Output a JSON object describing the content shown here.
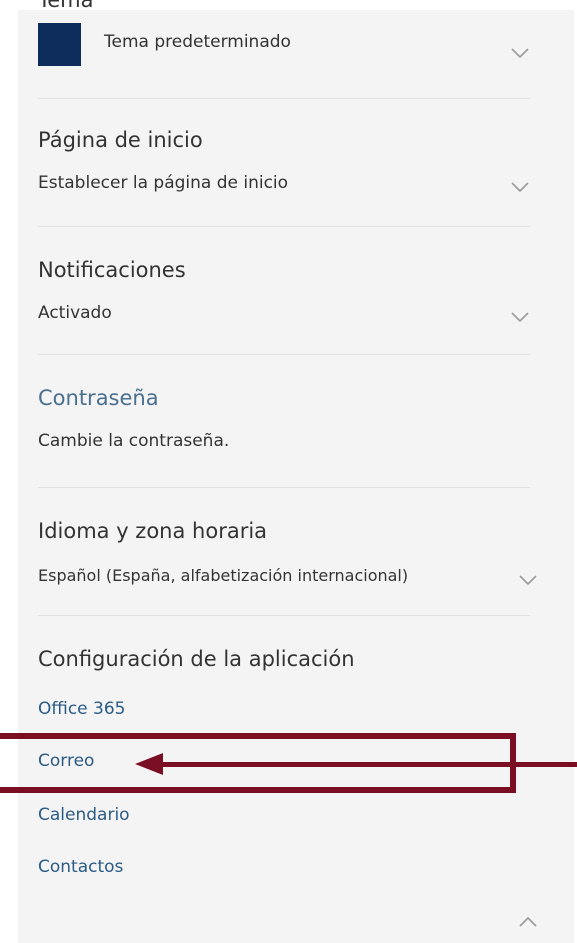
{
  "theme": {
    "title": "Tema",
    "value": "Tema predeterminado",
    "swatch_color": "#0e2d5c"
  },
  "homepage": {
    "title": "Página de inicio",
    "value": "Establecer la página de inicio"
  },
  "notifications": {
    "title": "Notificaciones",
    "value": "Activado"
  },
  "password": {
    "title": "Contraseña",
    "value": "Cambie la contraseña."
  },
  "language": {
    "title": "Idioma y zona horaria",
    "value": "Español (España, alfabetización internacional)"
  },
  "app_settings": {
    "title": "Configuración de la aplicación",
    "links": [
      "Office 365",
      "Correo",
      "Calendario",
      "Contactos"
    ]
  },
  "annotation": {
    "color": "#7a0f23"
  },
  "icons": {
    "chevron_down": "chevron-down-icon",
    "chevron_up": "chevron-up-icon"
  }
}
